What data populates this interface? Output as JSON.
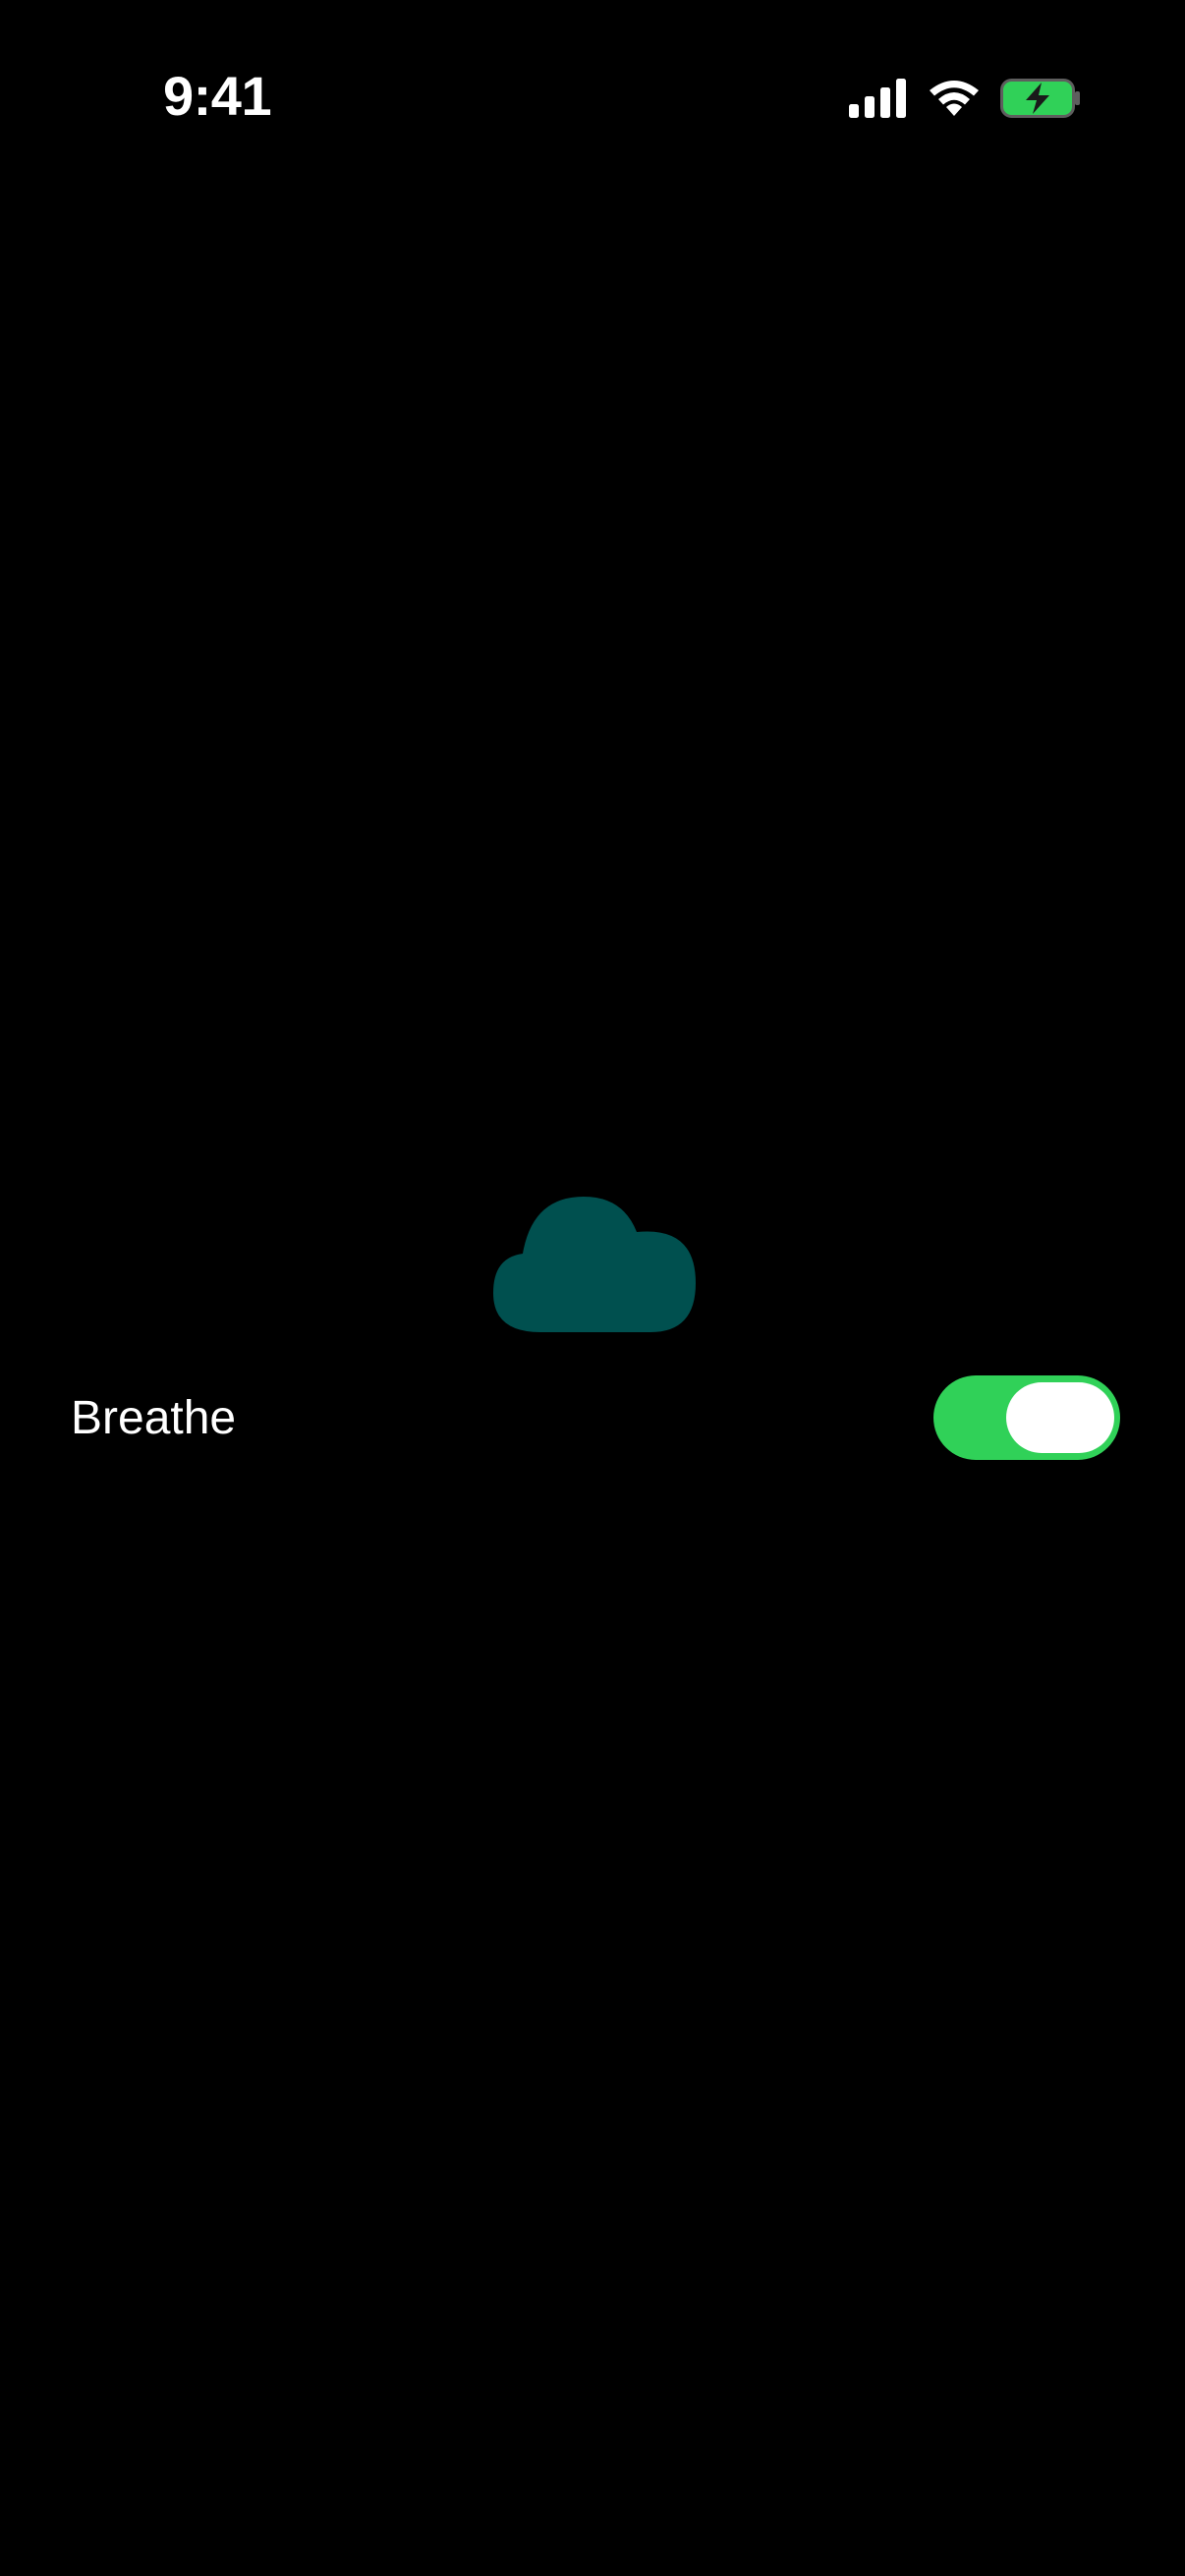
{
  "status_bar": {
    "time": "9:41",
    "icons": [
      "cellular-signal-icon",
      "wifi-icon",
      "battery-charging-icon"
    ],
    "battery_color": "#30D158"
  },
  "main": {
    "cloud_icon": "cloud-icon",
    "cloud_color": "#00504F"
  },
  "breathe": {
    "label": "Breathe",
    "toggle_on": true,
    "toggle_color": "#30D158"
  }
}
